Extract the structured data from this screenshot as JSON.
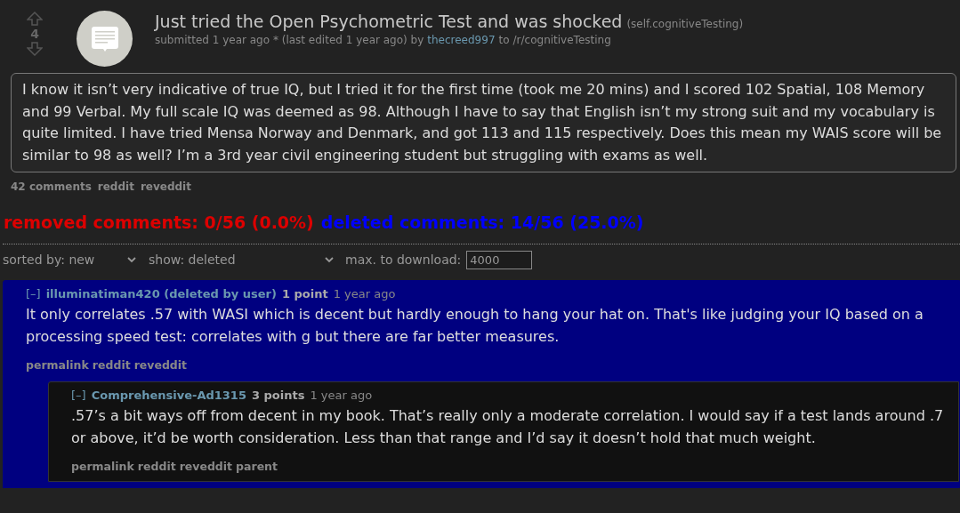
{
  "post": {
    "score": "4",
    "title": "Just tried the Open Psychometric Test and was shocked",
    "domain": "(self.cognitiveTesting)",
    "submitted": "submitted 1 year ago * (last edited 1 year ago) by",
    "author": "thecreed997",
    "to": "to",
    "subreddit": "/r/cognitiveTesting",
    "selftext": "I know it isn’t very indicative of true IQ, but I tried it for the first time (took me 20 mins) and I scored 102 Spatial, 108 Memory and 99 Verbal. My full scale IQ was deemed as 98. Although I have to say that English isn’t my strong suit and my vocabulary is quite limited. I have tried Mensa Norway and Denmark, and got 113 and 115 respectively. Does this mean my WAIS score will be similar to 98 as well? I’m a 3rd year civil engineering student but struggling with exams as well.",
    "links": [
      "42 comments",
      "reddit",
      "reveddit"
    ]
  },
  "stats": {
    "removed": "removed comments: 0/56 (0.0%)",
    "deleted": "deleted comments: 14/56 (25.0%)"
  },
  "controls": {
    "sort": "sorted by: new",
    "show": "show: deleted",
    "max_label": "max. to download:",
    "max_value": "4000"
  },
  "comments": [
    {
      "toggle": "[–]",
      "author": "illuminatiman420 (deleted by user)",
      "points": "1 point",
      "time": "1 year ago",
      "deleted": true,
      "body": "It only correlates .57 with WASI which is decent but hardly enough to hang your hat on. That's like judging your IQ based on a processing speed test: correlates with g but there are far better measures.",
      "links": [
        "permalink",
        "reddit",
        "reveddit"
      ],
      "children": [
        {
          "toggle": "[–]",
          "author": "Comprehensive-Ad1315",
          "points": "3 points",
          "time": "1 year ago",
          "deleted": false,
          "body": ".57’s a bit ways off from decent in my book. That’s really only a moderate correlation. I would say if a test lands around .7 or above, it’d be worth consideration. Less than that range and I’d say it doesn’t hold that much weight.",
          "links": [
            "permalink",
            "reddit",
            "reveddit",
            "parent"
          ]
        }
      ]
    }
  ]
}
